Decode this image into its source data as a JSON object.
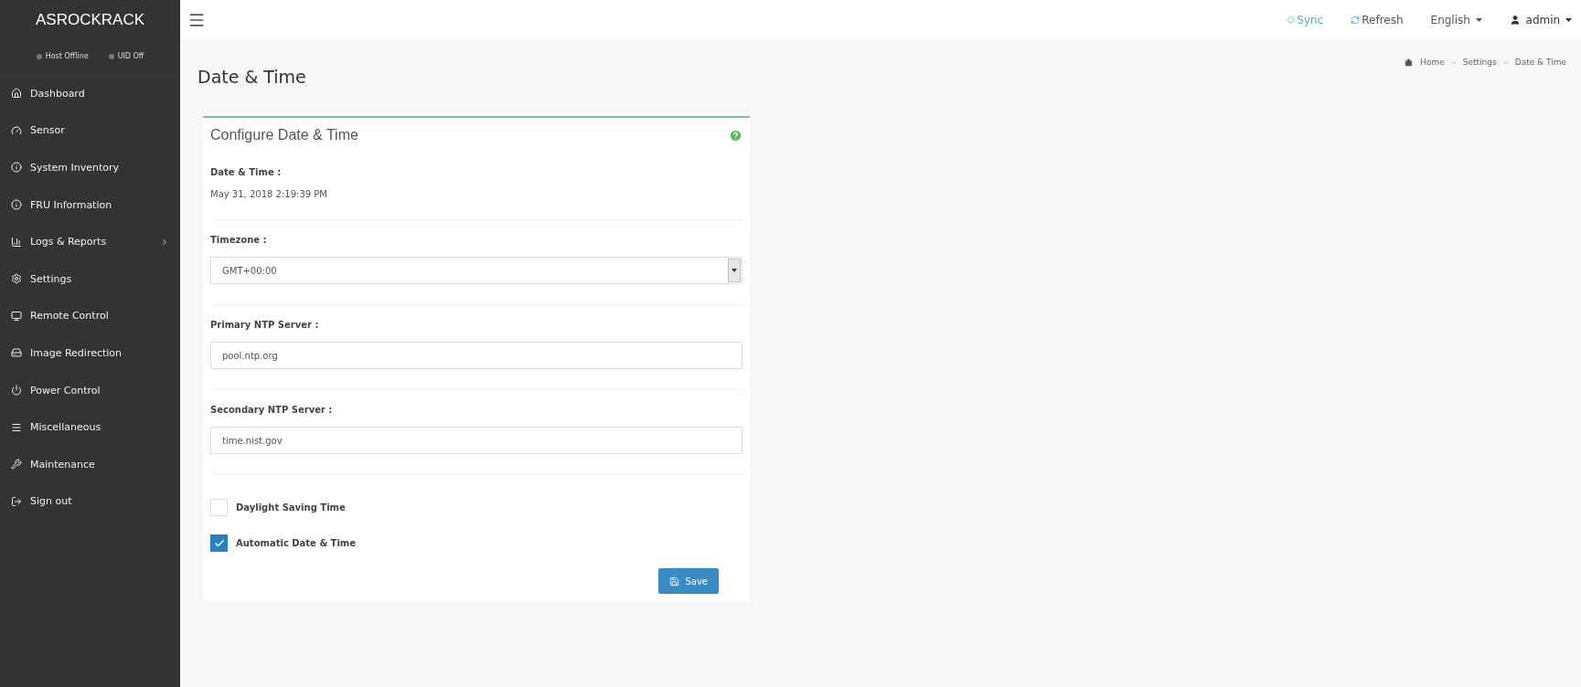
{
  "sidebar": {
    "brand": "ASROCKRACK",
    "status": [
      {
        "label": "Host Offline"
      },
      {
        "label": "UID Off"
      }
    ],
    "items": [
      {
        "label": "Dashboard",
        "has_submenu": false
      },
      {
        "label": "Sensor",
        "has_submenu": false
      },
      {
        "label": "System Inventory",
        "has_submenu": false
      },
      {
        "label": "FRU Information",
        "has_submenu": false
      },
      {
        "label": "Logs & Reports",
        "has_submenu": true
      },
      {
        "label": "Settings",
        "has_submenu": false
      },
      {
        "label": "Remote Control",
        "has_submenu": false
      },
      {
        "label": "Image Redirection",
        "has_submenu": false
      },
      {
        "label": "Power Control",
        "has_submenu": false
      },
      {
        "label": "Miscellaneous",
        "has_submenu": false
      },
      {
        "label": "Maintenance",
        "has_submenu": false
      },
      {
        "label": "Sign out",
        "has_submenu": false
      }
    ]
  },
  "topbar": {
    "sync": "Sync",
    "refresh": "Refresh",
    "language": "English",
    "user": "admin"
  },
  "page_title": "Date & Time",
  "breadcrumb": [
    "Home",
    "Settings",
    "Date & Time"
  ],
  "card": {
    "title": "Configure Date & Time",
    "current_label": "Date & Time :",
    "current_value": "May 31, 2018 2:19:39 PM",
    "timezone": {
      "label": "Timezone :",
      "value": "GMT+00:00"
    },
    "primary_ntp": {
      "label": "Primary NTP Server :",
      "value": "pool.ntp.org"
    },
    "secondary_ntp": {
      "label": "Secondary NTP Server :",
      "value": "time.nist.gov"
    },
    "options": [
      {
        "label": "Daylight Saving Time",
        "checked": false
      },
      {
        "label": "Automatic Date & Time",
        "checked": true
      }
    ],
    "save": "Save"
  }
}
